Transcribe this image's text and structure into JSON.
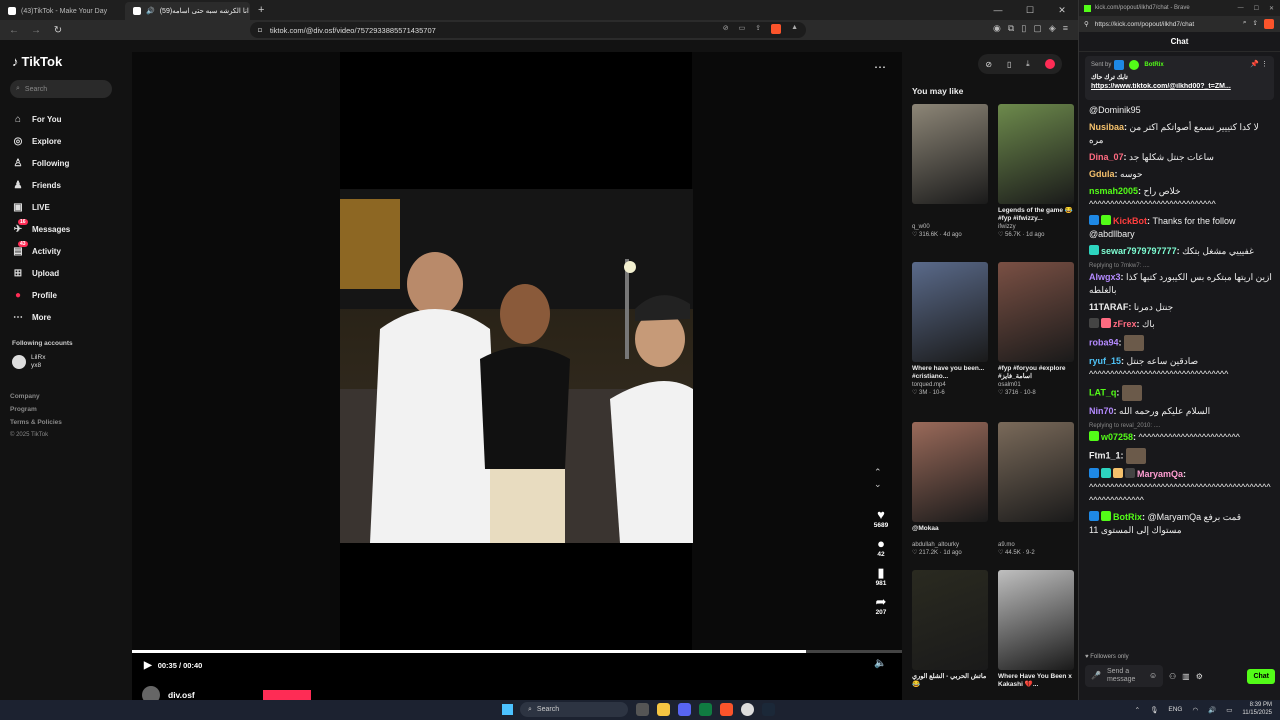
{
  "browser_left": {
    "tabs": [
      {
        "label": "(43)TikTok - Make Your Day",
        "active": false
      },
      {
        "label": "(59)انا الكرشه سبه حتى اسامه | TikTok",
        "active": true
      }
    ],
    "window_controls": [
      "—",
      "☐",
      "✕"
    ],
    "url": "tiktok.com/@div.osf/video/7572933885571435707"
  },
  "tiktok": {
    "logo": "TikTok",
    "search_placeholder": "Search",
    "nav": [
      {
        "label": "For You",
        "icon": "home-icon",
        "glyph": "⌂"
      },
      {
        "label": "Explore",
        "icon": "compass-icon",
        "glyph": "◎"
      },
      {
        "label": "Following",
        "icon": "following-icon",
        "glyph": "♙"
      },
      {
        "label": "Friends",
        "icon": "friends-icon",
        "glyph": "♟"
      },
      {
        "label": "LIVE",
        "icon": "live-icon",
        "glyph": "▣"
      },
      {
        "label": "Messages",
        "icon": "messages-icon",
        "glyph": "✈",
        "badge": "16"
      },
      {
        "label": "Activity",
        "icon": "activity-icon",
        "glyph": "▤",
        "badge": "43"
      },
      {
        "label": "Upload",
        "icon": "upload-icon",
        "glyph": "⊞"
      },
      {
        "label": "Profile",
        "icon": "profile-icon",
        "glyph": "●"
      },
      {
        "label": "More",
        "icon": "more-icon",
        "glyph": "⋯"
      }
    ],
    "following_heading": "Following accounts",
    "following": [
      {
        "name": "LilRx",
        "handle": "yx8"
      }
    ],
    "footer": [
      "Company",
      "Program",
      "Terms & Policies"
    ],
    "copyright": "© 2025 TikTok",
    "video": {
      "time": "00:35 / 00:40",
      "progress": 0.875,
      "author": "div.osf",
      "likes": "5689",
      "comments": "42",
      "saves": "981",
      "shares": "207"
    },
    "you_may_like_heading": "You may like",
    "recommendations": [
      {
        "title": "",
        "user": "q_w00",
        "stats": "♡ 316.6K · 4d ago",
        "color": "#8d8677"
      },
      {
        "title": "Legends of the game 😂 #fyp #ifwizzy...",
        "user": "ifwizzy",
        "stats": "♡ 56.7K · 1d ago",
        "color": "#6d8a4c"
      },
      {
        "title": "Where have you been... #cristiano...",
        "user": "torqued.mp4",
        "stats": "♡ 3M · 10-6",
        "color": "#5a6a8a"
      },
      {
        "title": "#fyp #foryou #explore #اسامة_فايز",
        "user": "osalm01",
        "stats": "♡ 3716 · 10-8",
        "color": "#7a5044"
      },
      {
        "title": "@Mokaa",
        "user": "abdullah_altourky",
        "stats": "♡ 217.2K · 1d ago",
        "color": "#9a6a5a"
      },
      {
        "title": "",
        "user": "a9.mo",
        "stats": "♡ 44.5K · 9-2",
        "color": "#7a6a5a"
      },
      {
        "title": "ماتش الحربي - الشلع الوري 😂",
        "user": "",
        "stats": "",
        "color": "#2a2a20"
      },
      {
        "title": "Where Have You Been x Kakashi 💔...",
        "user": "",
        "stats": "",
        "color": "#bfbfbf"
      }
    ]
  },
  "browser_right": {
    "title": "kick.com/popout/ilkhd7/chat - Brave",
    "url": "https://kick.com/popout/ilkhd7/chat",
    "chat_heading": "Chat",
    "pinned": {
      "sent_by_label": "Sent by",
      "sender": "BotRix",
      "text": "تابك ترك حاك",
      "link": "https://www.tiktok.com/@ilkhd00?_t=ZM..."
    },
    "messages": [
      {
        "user": "",
        "color": "#eeeeee",
        "text": "@Dominik95"
      },
      {
        "user": "Nusibaa",
        "color": "#f5c16c",
        "text": "لا كدا كتييير نسمع أصواتكم اكتر من مره"
      },
      {
        "user": "Dina_07",
        "color": "#ff6b81",
        "text": "ساعات جنتل شكلها جد"
      },
      {
        "user": "Gdula",
        "color": "#f5c16c",
        "text": "حوسه"
      },
      {
        "user": "nsmah2005",
        "color": "#53fc18",
        "text": "خلاص راح ^^^^^^^^^^^^^^^^^^^^^^^^^^^^^^"
      },
      {
        "user": "KickBot",
        "color": "#ff3e3e",
        "text": "Thanks for the follow @abdllbary",
        "badges": [
          "#1e88e5",
          "#53fc18"
        ]
      },
      {
        "user": "sewar7979797777",
        "color": "#7fffd4",
        "text": "غفيييي مشغل بتكك",
        "badges": [
          "#2dd4bf"
        ]
      },
      {
        "reply": "Replying to 7mkw7: ....",
        "user": "Alwgx3",
        "color": "#b48aff",
        "text": "ازين اريتها مبتكره بس الكيبورد كتبها كذا بالغلطه"
      },
      {
        "user": "11TARAF",
        "color": "#eeeeee",
        "text": "جنتل دمرنا"
      },
      {
        "user": "zFrex",
        "color": "#ff6b81",
        "text": "باك",
        "badges": [
          "#444",
          "#ff6b81"
        ]
      },
      {
        "user": "roba94",
        "color": "#b48aff",
        "text": "",
        "emote": true
      },
      {
        "user": "ryuf_15",
        "color": "#4fc3f7",
        "text": "صادقين ساعه جنتل ^^^^^^^^^^^^^^^^^^^^^^^^^^^^^^^^^"
      },
      {
        "user": "LAT_q",
        "color": "#53fc18",
        "text": "",
        "emote": true
      },
      {
        "user": "Nin70",
        "color": "#b48aff",
        "text": "السلام عليكم ورحمه الله"
      },
      {
        "reply": "Replying to reval_2010: ....",
        "user": "w07258",
        "color": "#53fc18",
        "text": "^^^^^^^^^^^^^^^^^^^^^^^^",
        "badges": [
          "#53fc18"
        ]
      },
      {
        "user": "Ftm1_1",
        "color": "#eeeeee",
        "text": "",
        "emote": true
      },
      {
        "user": "MaryamQa",
        "color": "#ff9ed2",
        "text": "^^^^^^^^^^^^^^^^^^^^^^^^^^^^^^^^^^^^^^^^^^^^^^^^^^^^^^^^",
        "badges": [
          "#1e88e5",
          "#2dd4bf",
          "#f5c16c",
          "#444"
        ]
      },
      {
        "user": "BotRix",
        "color": "#53fc18",
        "text": "@MaryamQa قمت برفع مستواك إلى المستوى 11",
        "badges": [
          "#1e88e5",
          "#53fc18"
        ]
      }
    ],
    "followers_only": "Followers only",
    "input_placeholder": "Send a message",
    "chat_button": "Chat"
  },
  "taskbar": {
    "search_placeholder": "Search",
    "lang": "ENG",
    "time": "8:39 PM",
    "date": "11/15/2025"
  },
  "colors": {
    "tiktok_red": "#fe2c55",
    "kick_green": "#53fc18",
    "brave_orange": "#fb542b"
  }
}
